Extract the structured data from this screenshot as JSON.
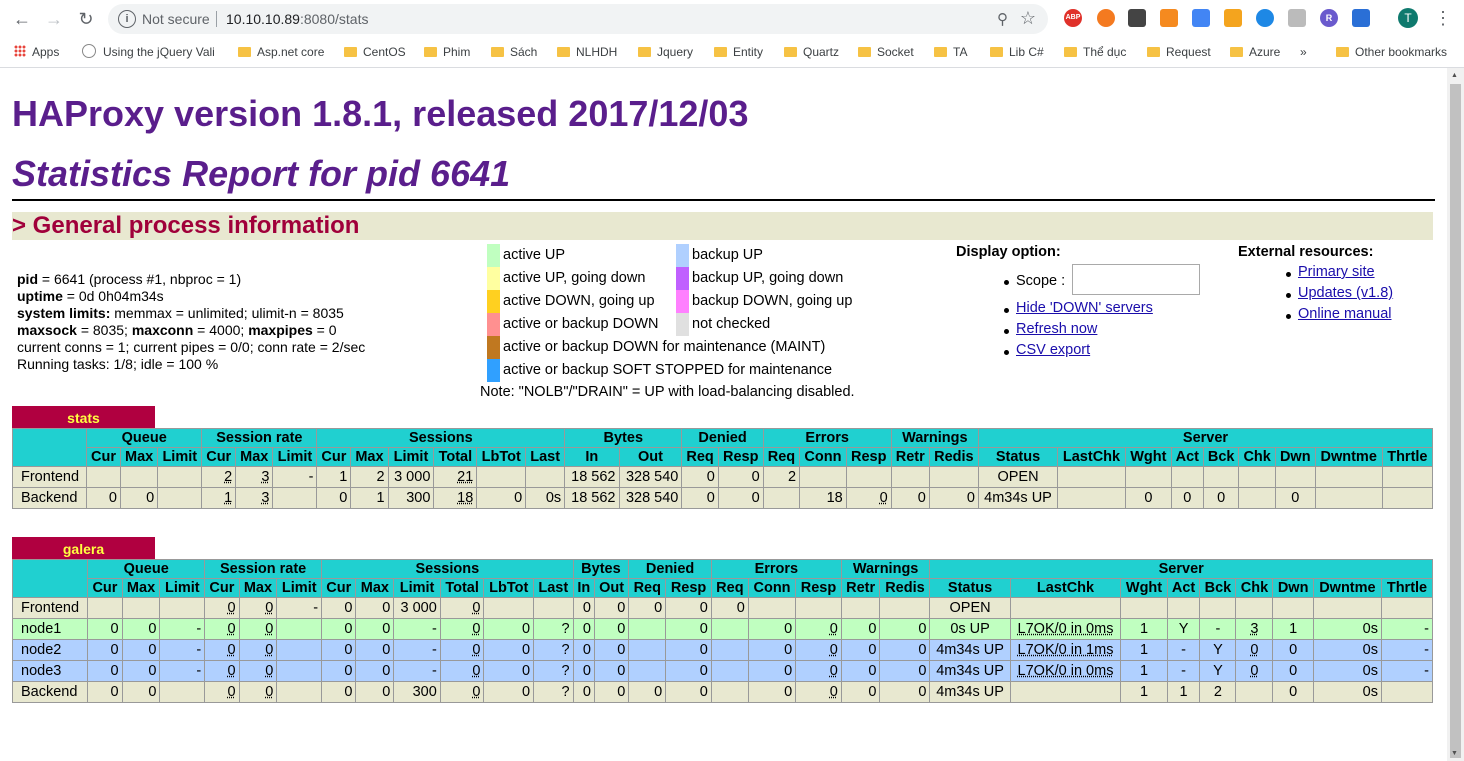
{
  "browser": {
    "security_label": "Not secure",
    "url_host": "10.10.10.89",
    "url_rest": ":8080/stats",
    "bookmarks": [
      "Apps",
      "Using the jQuery Vali",
      "Asp.net core",
      "CentOS",
      "Phim",
      "Sách",
      "NLHDH",
      "Jquery",
      "Entity",
      "Quartz",
      "Socket",
      "TA",
      "Lib C#",
      "Thể dục",
      "Request",
      "Azure",
      "»",
      "Other bookmarks"
    ],
    "avatar_letter": "T",
    "extensions": [
      "ABP",
      "",
      "",
      "",
      "",
      "",
      "",
      "",
      "R",
      ""
    ]
  },
  "page": {
    "title": "HAProxy version 1.8.1, released 2017/12/03",
    "subtitle": "Statistics Report for pid 6641",
    "section": "> General process information"
  },
  "general": {
    "pid_label": "pid",
    "pid_value": " = 6641 (process #1, nbproc = 1)",
    "uptime_label": "uptime",
    "uptime_value": " = 0d 0h04m34s",
    "limits_label": "system limits:",
    "limits_value": " memmax = unlimited; ulimit-n = 8035",
    "maxsock_label": "maxsock",
    "maxsock_value": " = 8035; ",
    "maxconn_label": "maxconn",
    "maxconn_value": " = 4000; ",
    "maxpipes_label": "maxpipes",
    "maxpipes_value": " = 0",
    "current": "current conns = 1; current pipes = 0/0; conn rate = 2/sec",
    "tasks": "Running tasks: 1/8; idle = 100 %"
  },
  "legend": {
    "left": [
      {
        "label": "active UP",
        "color": "#c0ffc0"
      },
      {
        "label": "active UP, going down",
        "color": "#ffffa0"
      },
      {
        "label": "active DOWN, going up",
        "color": "#ffd020"
      },
      {
        "label": "active or backup DOWN",
        "color": "#ff9090"
      },
      {
        "label": "active or backup DOWN for maintenance (MAINT)",
        "color": "#c07820"
      },
      {
        "label": "active or backup SOFT STOPPED for maintenance",
        "color": "#30a0ff"
      }
    ],
    "right": [
      {
        "label": "backup UP",
        "color": "#b0d0ff"
      },
      {
        "label": "backup UP, going down",
        "color": "#c060ff"
      },
      {
        "label": "backup DOWN, going up",
        "color": "#ff80ff"
      },
      {
        "label": "not checked",
        "color": "#e0e0e0"
      }
    ],
    "note": "Note: \"NOLB\"/\"DRAIN\" = UP with load-balancing disabled."
  },
  "display": {
    "heading": "Display option:",
    "scope_label": "Scope :",
    "links": [
      "Hide 'DOWN' servers",
      "Refresh now",
      "CSV export"
    ]
  },
  "external": {
    "heading": "External resources:",
    "links": [
      "Primary site",
      "Updates (v1.8)",
      "Online manual"
    ]
  },
  "stats": {
    "name": "stats",
    "groups": [
      "Queue",
      "Session rate",
      "Sessions",
      "Bytes",
      "Denied",
      "Errors",
      "Warnings",
      "Server"
    ],
    "columns": [
      "Cur",
      "Max",
      "Limit",
      "Cur",
      "Max",
      "Limit",
      "Cur",
      "Max",
      "Limit",
      "Total",
      "LbTot",
      "Last",
      "In",
      "Out",
      "Req",
      "Resp",
      "Req",
      "Conn",
      "Resp",
      "Retr",
      "Redis",
      "Status",
      "LastChk",
      "Wght",
      "Act",
      "Bck",
      "Chk",
      "Dwn",
      "Dwntme",
      "Thrtle"
    ],
    "rows": [
      {
        "name": "Frontend",
        "cells": [
          "",
          "",
          "",
          "2",
          "3",
          "-",
          "1",
          "2",
          "3 000",
          "21",
          "",
          "",
          "18 562",
          "328 540",
          "0",
          "0",
          "2",
          "",
          "",
          "",
          "",
          "OPEN",
          "",
          "",
          "",
          "",
          "",
          "",
          "",
          ""
        ]
      },
      {
        "name": "Backend",
        "cells": [
          "0",
          "0",
          "",
          "1",
          "3",
          "",
          "0",
          "1",
          "300",
          "18",
          "0",
          "0s",
          "18 562",
          "328 540",
          "0",
          "0",
          "",
          "18",
          "0",
          "0",
          "0",
          "4m34s UP",
          "",
          "0",
          "0",
          "0",
          "",
          "0",
          "",
          ""
        ]
      }
    ]
  },
  "galera": {
    "name": "galera",
    "groups": [
      "Queue",
      "Session rate",
      "Sessions",
      "Bytes",
      "Denied",
      "Errors",
      "Warnings",
      "Server"
    ],
    "columns": [
      "Cur",
      "Max",
      "Limit",
      "Cur",
      "Max",
      "Limit",
      "Cur",
      "Max",
      "Limit",
      "Total",
      "LbTot",
      "Last",
      "In",
      "Out",
      "Req",
      "Resp",
      "Req",
      "Conn",
      "Resp",
      "Retr",
      "Redis",
      "Status",
      "LastChk",
      "Wght",
      "Act",
      "Bck",
      "Chk",
      "Dwn",
      "Dwntme",
      "Thrtle"
    ],
    "rows": [
      {
        "name": "Frontend",
        "cls": "fe",
        "cells": [
          "",
          "",
          "",
          "0",
          "0",
          "-",
          "0",
          "0",
          "3 000",
          "0",
          "",
          "",
          "0",
          "0",
          "0",
          "0",
          "0",
          "",
          "",
          "",
          "",
          "OPEN",
          "",
          "",
          "",
          "",
          "",
          "",
          "",
          ""
        ]
      },
      {
        "name": "node1",
        "cls": "up",
        "cells": [
          "0",
          "0",
          "-",
          "0",
          "0",
          "",
          "0",
          "0",
          "-",
          "0",
          "0",
          "?",
          "0",
          "0",
          "",
          "0",
          "",
          "0",
          "0",
          "0",
          "0",
          "0s UP",
          "L7OK/0 in 0ms",
          "1",
          "Y",
          "-",
          "3",
          "1",
          "0s",
          "-"
        ]
      },
      {
        "name": "node2",
        "cls": "bk",
        "cells": [
          "0",
          "0",
          "-",
          "0",
          "0",
          "",
          "0",
          "0",
          "-",
          "0",
          "0",
          "?",
          "0",
          "0",
          "",
          "0",
          "",
          "0",
          "0",
          "0",
          "0",
          "4m34s UP",
          "L7OK/0 in 1ms",
          "1",
          "-",
          "Y",
          "0",
          "0",
          "0s",
          "-"
        ]
      },
      {
        "name": "node3",
        "cls": "bk",
        "cells": [
          "0",
          "0",
          "-",
          "0",
          "0",
          "",
          "0",
          "0",
          "-",
          "0",
          "0",
          "?",
          "0",
          "0",
          "",
          "0",
          "",
          "0",
          "0",
          "0",
          "0",
          "4m34s UP",
          "L7OK/0 in 0ms",
          "1",
          "-",
          "Y",
          "0",
          "0",
          "0s",
          "-"
        ]
      },
      {
        "name": "Backend",
        "cls": "be",
        "cells": [
          "0",
          "0",
          "",
          "0",
          "0",
          "",
          "0",
          "0",
          "300",
          "0",
          "0",
          "?",
          "0",
          "0",
          "0",
          "0",
          "",
          "0",
          "0",
          "0",
          "0",
          "4m34s UP",
          "",
          "1",
          "1",
          "2",
          "",
          "0",
          "0s",
          ""
        ]
      }
    ]
  }
}
